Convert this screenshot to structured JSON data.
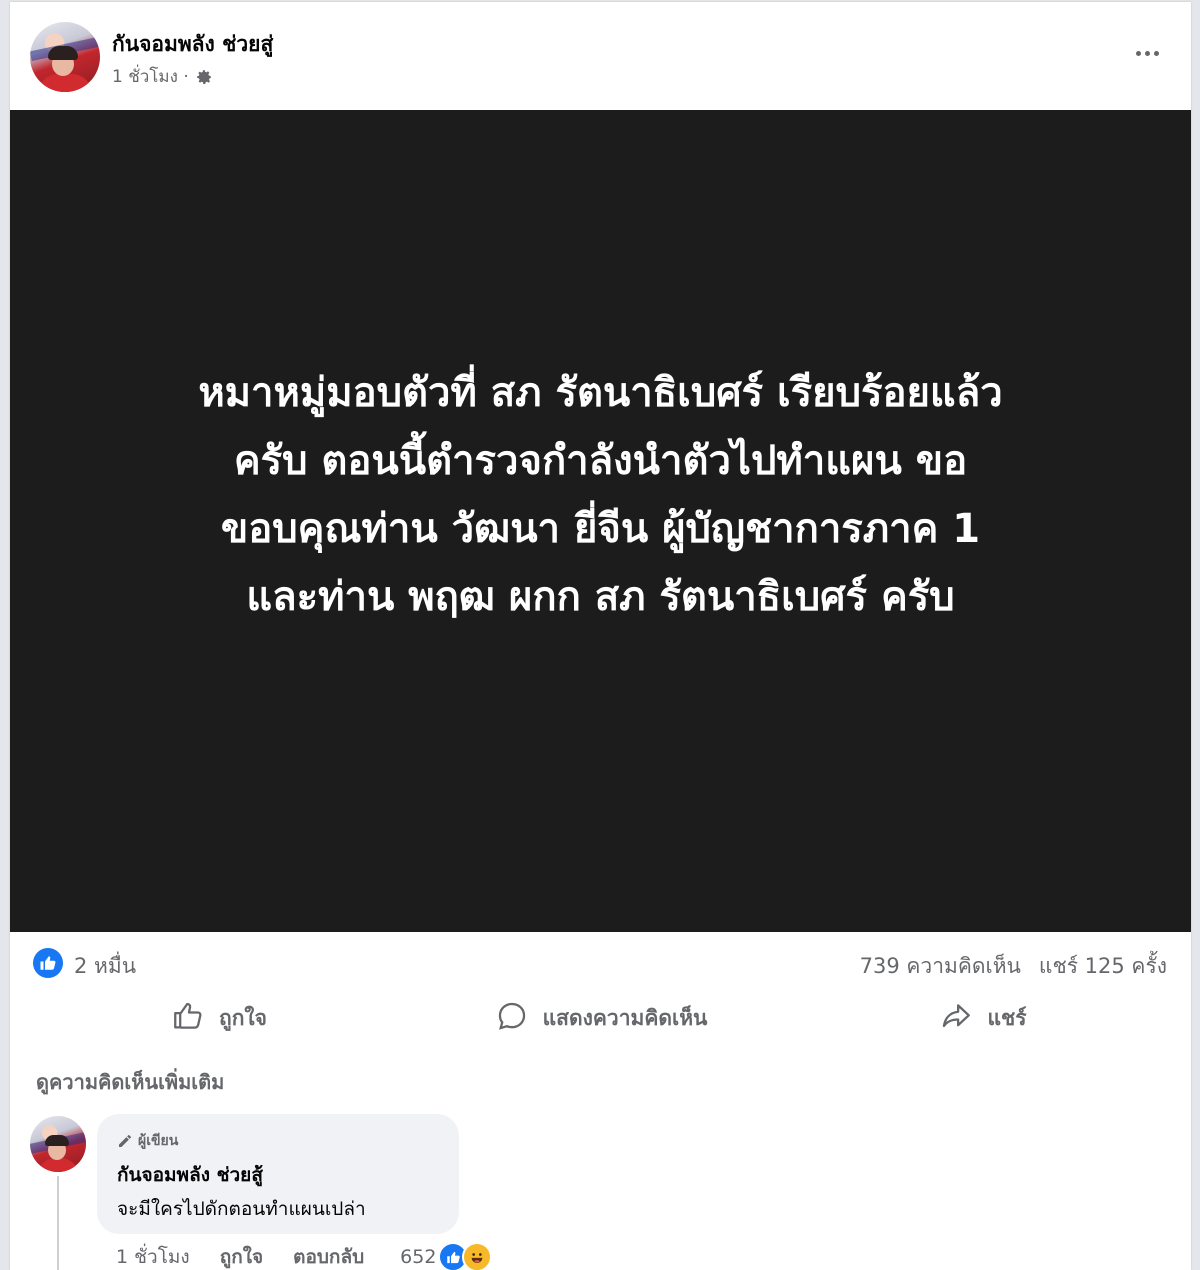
{
  "post": {
    "author": "กันจอมพลัง ช่วยสู่",
    "time": "1 ชั่วโมง ·",
    "privacy_icon": "gear-icon",
    "more_icon": "more-horizontal-icon",
    "text_lines": [
      "หมาหมู่มอบตัวที่ สภ รัตนาธิเบศร์ เรียบร้อยแล้ว",
      "ครับ ตอนนี้ตำรวจกำลังนำตัวไปทำแผน ขอ",
      "ขอบคุณท่าน วัฒนา ยี่จีน ผู้บัญชาการภาค 1",
      "และท่าน พฤฒ ผกก สภ รัตนาธิเบศร์ ครับ"
    ],
    "background_color": "#1c1c1d"
  },
  "stats": {
    "reactions": "2 หมื่น",
    "comments": "739 ความคิดเห็น",
    "shares": "แชร์ 125 ครั้ง"
  },
  "actions": {
    "like": "ถูกใจ",
    "comment": "แสดงความคิดเห็น",
    "share": "แชร์"
  },
  "more_comments": "ดูความคิดเห็นเพิ่มเติม",
  "comment": {
    "badge": "ผู้เขียน",
    "author": "กันจอมพลัง ช่วยสู้",
    "text": "จะมีใครไปดักตอนทำแผนเปล่า",
    "time": "1 ชั่วโมง",
    "like": "ถูกใจ",
    "reply": "ตอบกลับ",
    "reaction_count": "652"
  },
  "colors": {
    "accent": "#1877f2",
    "secondary_text": "#65676b"
  }
}
